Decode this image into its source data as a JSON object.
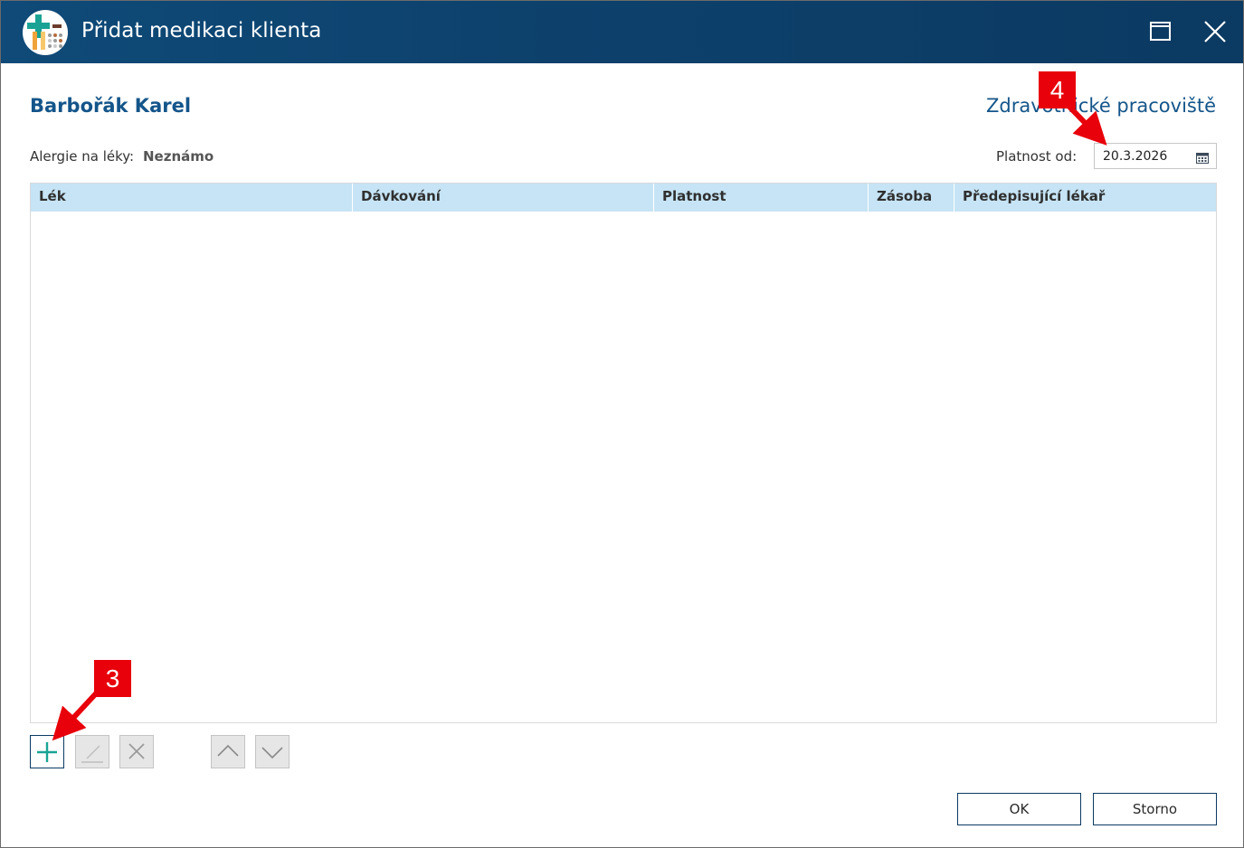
{
  "window": {
    "title": "Přidat medikaci klienta",
    "titlebar_color": "#0d416c"
  },
  "header": {
    "client_name": "Barbořák Karel",
    "workplace": "Zdravotnické pracoviště"
  },
  "allergy": {
    "label": "Alergie na léky:",
    "value": "Neznámo"
  },
  "validity": {
    "label": "Platnost od:",
    "date_value": "20.3.2026"
  },
  "grid": {
    "columns": [
      "Lék",
      "Dávkování",
      "Platnost",
      "Zásoba",
      "Předepisující lékař"
    ],
    "rows": [],
    "header_color": "#c6e4f5"
  },
  "toolbar": {
    "icons": [
      "plus-icon",
      "edit-icon",
      "delete-icon",
      "chevron-up-icon",
      "chevron-down-icon"
    ]
  },
  "buttons": {
    "ok": "OK",
    "cancel": "Storno"
  },
  "annotations": {
    "callout_3": "3",
    "callout_4": "4",
    "color": "#e8000b"
  }
}
